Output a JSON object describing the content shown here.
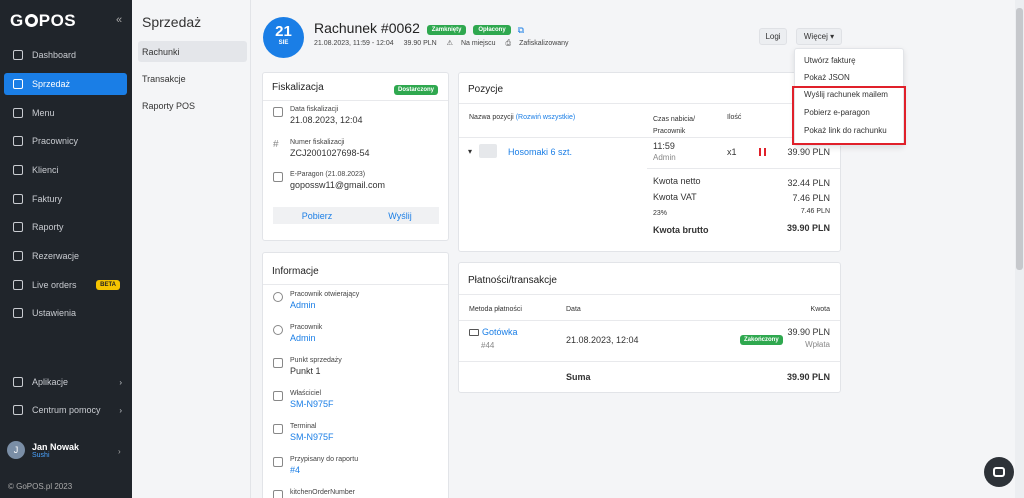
{
  "sidebar": {
    "logo": {
      "prefix": "G",
      "suffix": "POS"
    },
    "collapse_icon": "«",
    "items": [
      {
        "label": "Dashboard",
        "icon": "dashboard-icon"
      },
      {
        "label": "Sprzedaż",
        "icon": "sales-icon",
        "active": true
      },
      {
        "label": "Menu",
        "icon": "menu-icon"
      },
      {
        "label": "Pracownicy",
        "icon": "employees-icon"
      },
      {
        "label": "Klienci",
        "icon": "clients-icon"
      },
      {
        "label": "Faktury",
        "icon": "invoices-icon"
      },
      {
        "label": "Raporty",
        "icon": "reports-icon"
      },
      {
        "label": "Rezerwacje",
        "icon": "reservations-icon"
      },
      {
        "label": "Live orders",
        "icon": "live-orders-icon",
        "badge": "BETA"
      },
      {
        "label": "Ustawienia",
        "icon": "settings-icon"
      }
    ],
    "bottom_items": [
      {
        "label": "Aplikacje",
        "icon": "apps-icon",
        "chevron": "›"
      },
      {
        "label": "Centrum pomocy",
        "icon": "help-icon",
        "chevron": "›"
      }
    ],
    "user": {
      "initial": "J",
      "name": "Jan Nowak",
      "role": "Sushi",
      "chevron": "›"
    },
    "footer": "© GoPOS.pl 2023"
  },
  "subnav": {
    "title": "Sprzedaż",
    "items": [
      {
        "label": "Rachunki",
        "active": true
      },
      {
        "label": "Transakcje"
      },
      {
        "label": "Raporty POS"
      }
    ]
  },
  "header": {
    "day": "21",
    "month": "SIE",
    "title": "Rachunek #0062",
    "badges": [
      "Zamknięty",
      "Opłacony"
    ],
    "meta": [
      "21.08.2023, 11:59 - 12:04",
      "39.90 PLN",
      "Na miejscu",
      "Zafiskalizowany"
    ],
    "buttons": {
      "logi": "Logi",
      "wiecej": "Więcej"
    }
  },
  "dropdown": {
    "items": [
      "Utwórz fakturę",
      "Pokaż JSON",
      "Wyślij rachunek mailem",
      "Pobierz e-paragon",
      "Pokaż link do rachunku"
    ]
  },
  "fiskalizacja": {
    "title": "Fiskalizacja",
    "badge": "Dostarczony",
    "fields": [
      {
        "label": "Data fiskalizacji",
        "value": "21.08.2023, 12:04"
      },
      {
        "label": "Numer fiskalizacji",
        "value": "ZCJ2001027698-54"
      },
      {
        "label": "E-Paragon (21.08.2023)",
        "value": "gopossw11@gmail.com"
      }
    ],
    "actions": [
      "Pobierz",
      "Wyślij"
    ]
  },
  "informacje": {
    "title": "Informacje",
    "fields": [
      {
        "label": "Pracownik otwierający",
        "value": "Admin",
        "link": true
      },
      {
        "label": "Pracownik",
        "value": "Admin",
        "link": true
      },
      {
        "label": "Punkt sprzedaży",
        "value": "Punkt 1",
        "link": false
      },
      {
        "label": "Właściciel",
        "value": "SM-N975F",
        "link": true
      },
      {
        "label": "Terminal",
        "value": "SM-N975F",
        "link": true
      },
      {
        "label": "Przypisany do raportu",
        "value": "#4",
        "link": true
      },
      {
        "label": "kitchenOrderNumber",
        "value": "",
        "link": false
      }
    ]
  },
  "pozycje": {
    "title": "Pozycje",
    "columns": {
      "name": "Nazwa pozycji",
      "expand": "(Rozwiń wszystkie)",
      "time": "Czas nabicia/",
      "worker": "Pracownik",
      "qty": "Ilość"
    },
    "row": {
      "name": "Hosomaki 6 szt.",
      "time": "11:59",
      "worker": "Admin",
      "qty": "x1",
      "price": "39.90 PLN"
    },
    "totals": [
      {
        "label": "Kwota netto",
        "value": "32.44 PLN"
      },
      {
        "label": "Kwota VAT",
        "value": "7.46 PLN"
      },
      {
        "label": "23%",
        "value": "7.46 PLN"
      },
      {
        "label": "Kwota brutto",
        "value": "39.90 PLN"
      }
    ]
  },
  "platnosci": {
    "title": "Płatności/transakcje",
    "columns": {
      "method": "Metoda płatności",
      "date": "Data",
      "amount": "Kwota"
    },
    "row": {
      "method": "Gotówka",
      "id": "#44",
      "date": "21.08.2023, 12:04",
      "status": "Zakończony",
      "amount": "39.90 PLN",
      "type": "Wpłata"
    },
    "sum_label": "Suma",
    "sum_value": "39.90 PLN"
  }
}
